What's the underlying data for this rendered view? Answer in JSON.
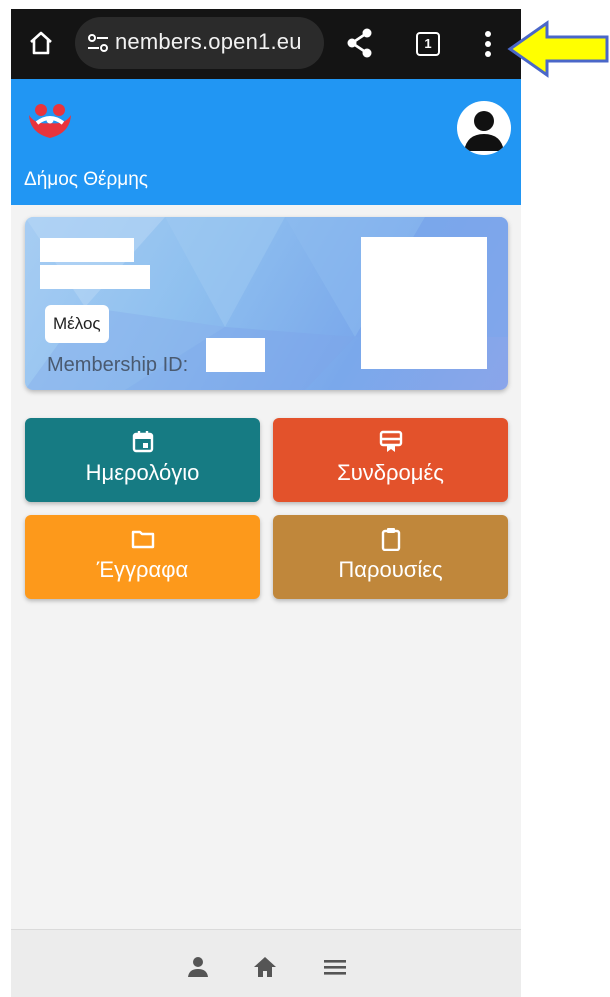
{
  "browser": {
    "url": "nembers.open1.eu",
    "tab_count": "1",
    "icons": [
      "home-icon",
      "site-settings-icon",
      "share-icon",
      "tab-switcher-icon",
      "more-vert-icon"
    ]
  },
  "header": {
    "org_name": "Δήμος Θέρμης",
    "colors": {
      "background": "#2196f3",
      "logo_red": "#e8343d"
    }
  },
  "member_card": {
    "role": "Μέλος",
    "membership_label": "Membership ID:"
  },
  "tiles": [
    {
      "label": "Ημερολόγιο",
      "icon": "calendar-icon",
      "color": "#167b83"
    },
    {
      "label": "Συνδρομές",
      "icon": "subscription-icon",
      "color": "#e3522b"
    },
    {
      "label": "Έγγραφα",
      "icon": "folder-icon",
      "color": "#fd991b"
    },
    {
      "label": "Παρουσίες",
      "icon": "clipboard-icon",
      "color": "#c0873b"
    }
  ],
  "bottom_nav": [
    "person-icon",
    "home-icon",
    "menu-icon"
  ],
  "annotation": {
    "arrow_color": "#ffff00",
    "icon": "arrow-left-icon"
  }
}
